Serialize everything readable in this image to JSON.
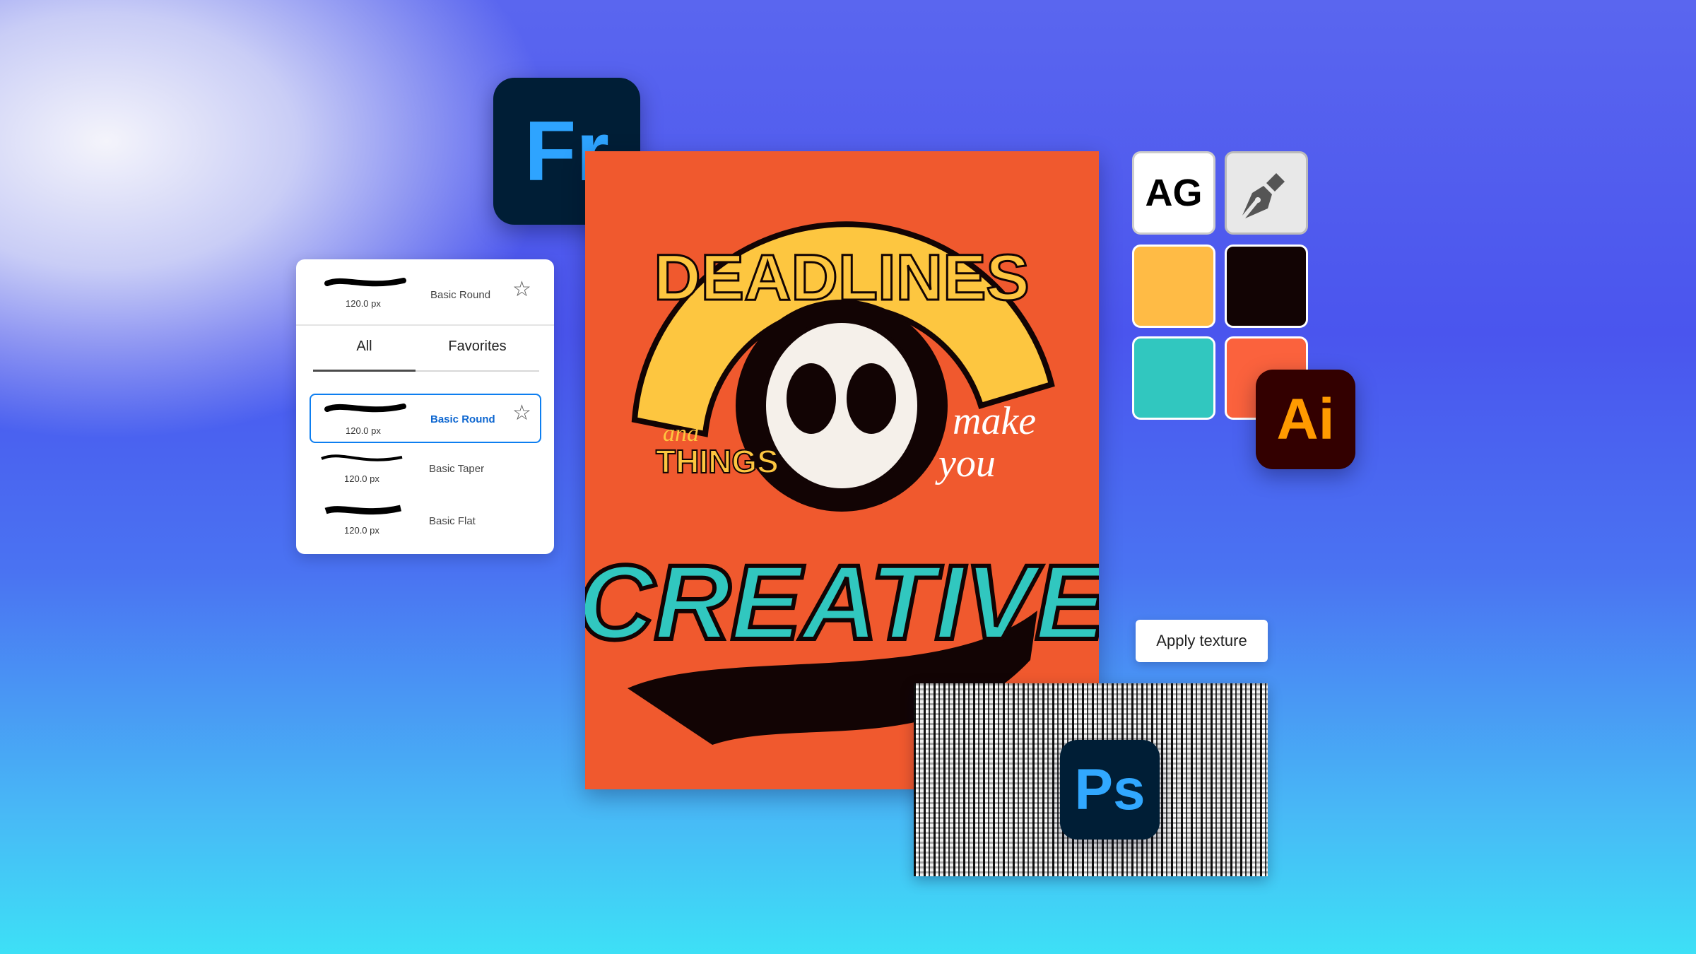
{
  "apps": {
    "fresco": "Fr",
    "illustrator": "Ai",
    "photoshop": "Ps"
  },
  "brush_panel": {
    "current": {
      "name": "Basic Round",
      "size": "120.0 px"
    },
    "tabs": [
      {
        "label": "All",
        "active": true
      },
      {
        "label": "Favorites",
        "active": false
      }
    ],
    "brushes": [
      {
        "name": "Basic Round",
        "size": "120.0 px",
        "selected": true
      },
      {
        "name": "Basic Taper",
        "size": "120.0 px",
        "selected": false
      },
      {
        "name": "Basic Flat",
        "size": "120.0 px",
        "selected": false
      }
    ]
  },
  "poster": {
    "lines": [
      "DEADLINES",
      "and",
      "THINGS",
      "make",
      "you",
      "CREATIVE"
    ]
  },
  "swatches": {
    "font_tile": "AG",
    "colors": [
      "#ffbb45",
      "#120404",
      "#31c7bf",
      "#fb623d"
    ],
    "accent": "#0d66d0"
  },
  "texture": {
    "button_label": "Apply texture"
  }
}
